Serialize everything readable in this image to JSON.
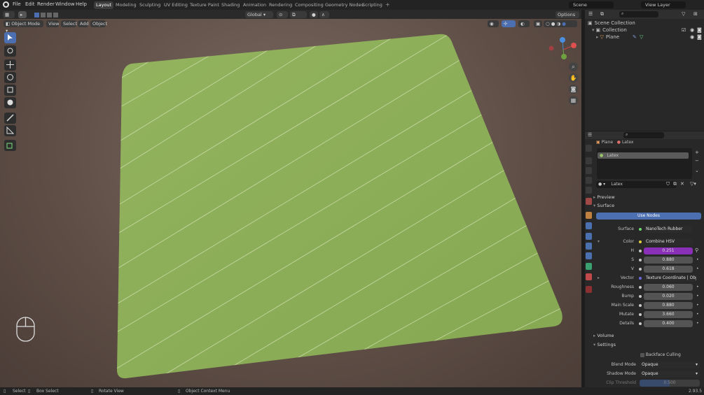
{
  "menu": [
    "File",
    "Edit",
    "Render",
    "Window",
    "Help"
  ],
  "workspaces": [
    "Layout",
    "Modeling",
    "Sculpting",
    "UV Editing",
    "Texture Paint",
    "Shading",
    "Animation",
    "Rendering",
    "Compositing",
    "Geometry Nodes",
    "Scripting"
  ],
  "active_workspace": "Layout",
  "scene_name": "Scene",
  "view_layer": "View Layer",
  "header": {
    "transform_orientation": "Global",
    "options": "Options",
    "mode": "Object Mode",
    "view": "View",
    "select": "Select",
    "add": "Add",
    "object": "Object"
  },
  "outliner": {
    "items": [
      {
        "label": "Scene Collection"
      },
      {
        "label": "Collection"
      },
      {
        "label": "Plane"
      }
    ]
  },
  "properties": {
    "breadcrumb_object": "Plane",
    "breadcrumb_material": "Latex",
    "slot": "Latex",
    "material_name": "Latex",
    "preview": "Preview",
    "surface_section": "Surface",
    "use_nodes": "Use Nodes",
    "surface_label": "Surface",
    "surface_value": "NanoTech Rubber",
    "color_label": "Color",
    "color_value": "Combine HSV",
    "h_label": "H",
    "h_value": "0.251",
    "s_label": "S",
    "s_value": "0.880",
    "v_label": "V",
    "v_value": "0.618",
    "vector_label": "Vector",
    "vector_value": "Texture Coordinate | Obje...",
    "roughness_label": "Roughness",
    "roughness_value": "0.060",
    "bump_label": "Bump",
    "bump_value": "0.020",
    "mainscale_label": "Main Scale",
    "mainscale_value": "0.880",
    "mutate_label": "Mutate",
    "mutate_value": "3.660",
    "details_label": "Details",
    "details_value": "0.400",
    "volume_section": "Volume",
    "settings_section": "Settings",
    "backface_culling": "Backface Culling",
    "blend_mode_label": "Blend Mode",
    "blend_mode_value": "Opaque",
    "shadow_mode_label": "Shadow Mode",
    "shadow_mode_value": "Opaque",
    "clip_label": "Clip Threshold",
    "clip_value": "0.500"
  },
  "status": {
    "select": "Select",
    "box_select": "Box Select",
    "rotate_view": "Rotate View",
    "context_menu": "Object Context Menu",
    "version": "2.93.5"
  },
  "colors": {
    "accent_blue": "#4b6fb0",
    "hue_field": "#8a2fb8",
    "plane_green": "#8fb05a"
  }
}
